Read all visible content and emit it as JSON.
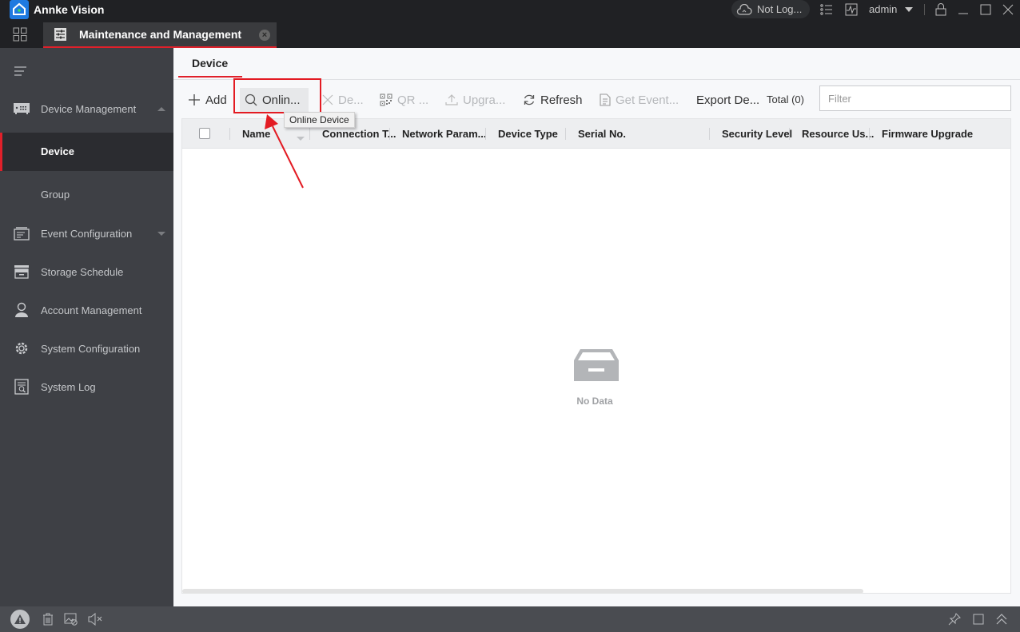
{
  "app": {
    "title": "Annke Vision",
    "cloud_status": "Not Log...",
    "user": "admin"
  },
  "tabs": {
    "main_tab_label": "Maintenance and Management"
  },
  "sidebar": {
    "items": [
      {
        "label": "Device Management",
        "icon": "device-management-icon",
        "expanded": true
      },
      {
        "label": "Device",
        "sub": true,
        "active": true
      },
      {
        "label": "Group",
        "sub": true
      },
      {
        "label": "Event Configuration",
        "icon": "event-icon",
        "expanded": false
      },
      {
        "label": "Storage Schedule",
        "icon": "storage-icon"
      },
      {
        "label": "Account Management",
        "icon": "user-icon"
      },
      {
        "label": "System Configuration",
        "icon": "gear-icon"
      },
      {
        "label": "System Log",
        "icon": "log-icon"
      }
    ]
  },
  "page": {
    "tab": "Device",
    "toolbar": {
      "add": "Add",
      "online": "Onlin...",
      "delete": "De...",
      "qr": "QR ...",
      "upgrade": "Upgra...",
      "refresh": "Refresh",
      "get_event": "Get Event...",
      "export": "Export De...",
      "total": "Total (0)",
      "filter_placeholder": "Filter"
    },
    "tooltip": "Online Device",
    "table": {
      "columns": [
        "Name",
        "Connection T...",
        "Network Param...",
        "Device Type",
        "Serial No.",
        "Security Level",
        "Resource Us...",
        "Firmware Upgrade"
      ],
      "rows": [],
      "empty_text": "No Data"
    }
  },
  "colors": {
    "accent": "#e0202a",
    "annotation": "#e31b23",
    "titlebar": "#202124",
    "sidebar": "#3e4045"
  }
}
